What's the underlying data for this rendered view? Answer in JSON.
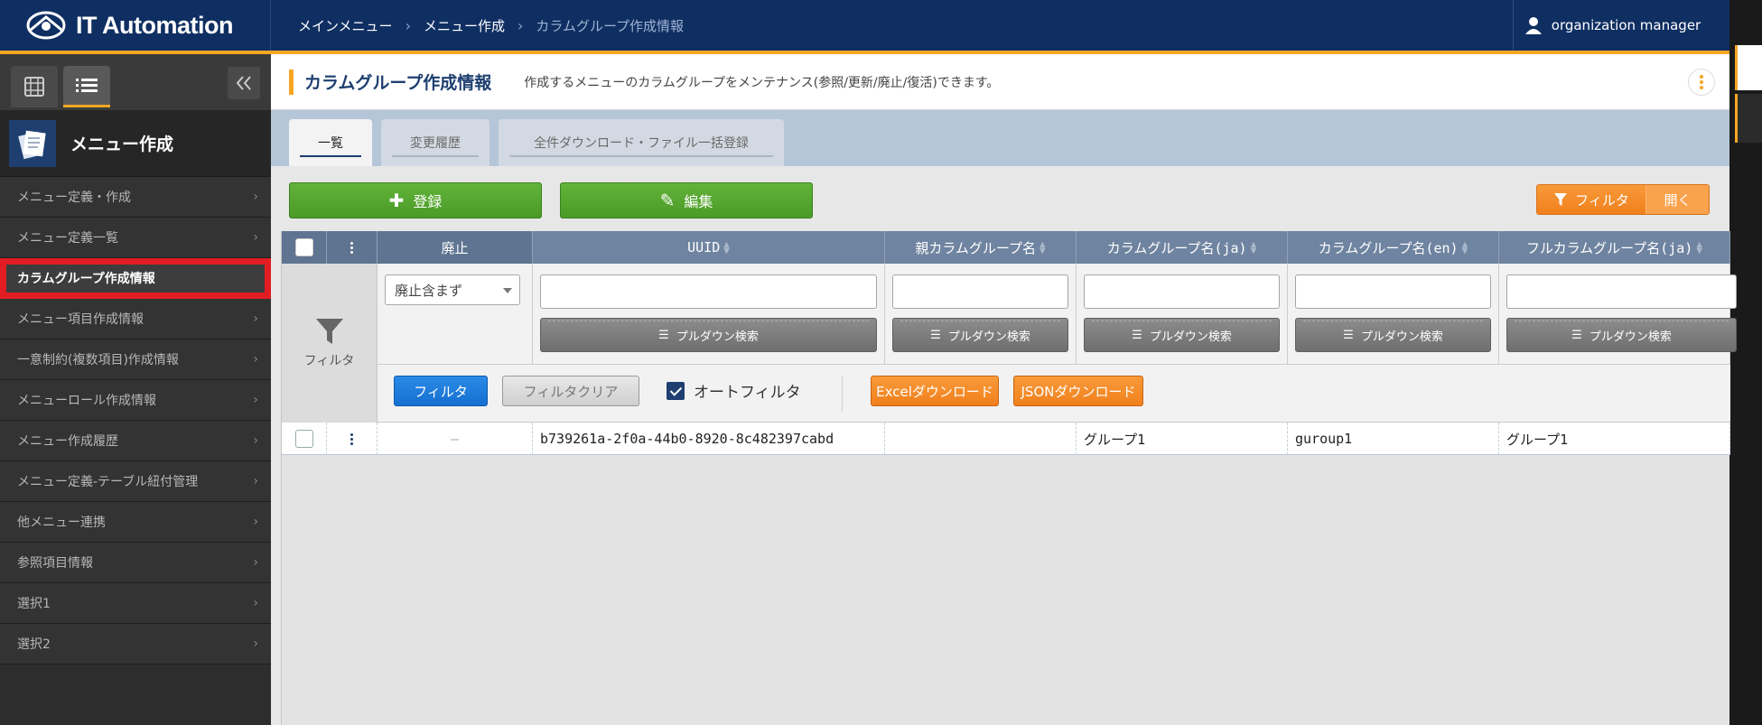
{
  "app": {
    "title": "IT Automation"
  },
  "breadcrumb": [
    "メインメニュー",
    "メニュー作成",
    "カラムグループ作成情報"
  ],
  "user": {
    "name": "organization manager"
  },
  "sidebar": {
    "group_title": "メニュー作成",
    "items": [
      {
        "label": "メニュー定義・作成"
      },
      {
        "label": "メニュー定義一覧"
      },
      {
        "label": "カラムグループ作成情報"
      },
      {
        "label": "メニュー項目作成情報"
      },
      {
        "label": "一意制約(複数項目)作成情報"
      },
      {
        "label": "メニューロール作成情報"
      },
      {
        "label": "メニュー作成履歴"
      },
      {
        "label": "メニュー定義-テーブル紐付管理"
      },
      {
        "label": "他メニュー連携"
      },
      {
        "label": "参照項目情報"
      },
      {
        "label": "選択1"
      },
      {
        "label": "選択2"
      }
    ]
  },
  "page": {
    "title": "カラムグループ作成情報",
    "description": "作成するメニューのカラムグループをメンテナンス(参照/更新/廃止/復活)できます。"
  },
  "tabs": [
    {
      "label": "一覧"
    },
    {
      "label": "変更履歴"
    },
    {
      "label": "全件ダウンロード・ファイル一括登録"
    }
  ],
  "toolbar": {
    "register_label": "登録",
    "edit_label": "編集",
    "filter_label": "フィルタ",
    "open_label": "開く"
  },
  "table": {
    "columns": [
      "廃止",
      "UUID",
      "親カラムグループ名",
      "カラムグループ名(ja)",
      "カラムグループ名(en)",
      "フルカラムグループ名(ja)"
    ],
    "filter": {
      "label": "フィルタ",
      "discard_select": "廃止含まず",
      "pulldown_label": "プルダウン検索",
      "filter_button": "フィルタ",
      "clear_button": "フィルタクリア",
      "auto_filter_label": "オートフィルタ",
      "excel_button": "Excelダウンロード",
      "json_button": "JSONダウンロード"
    },
    "rows": [
      {
        "discard": "—",
        "uuid": "b739261a-2f0a-44b0-8920-8c482397cabd",
        "parent": "",
        "name_ja": "グループ1",
        "name_en": "guroup1",
        "full_ja": "グループ1"
      }
    ]
  },
  "colors": {
    "header": "#0f2f62",
    "accent": "#f5a623",
    "green": "#4a9a26",
    "highlight": "#e11d23"
  }
}
